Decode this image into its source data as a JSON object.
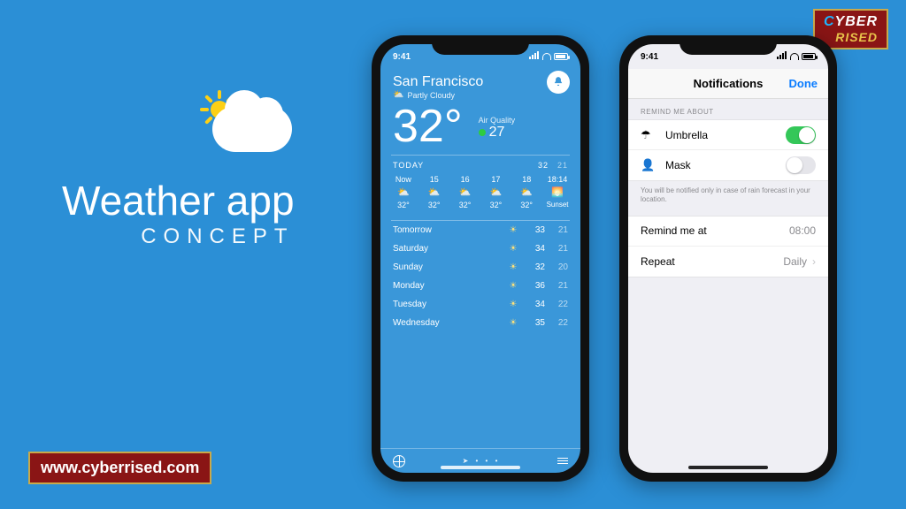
{
  "brand": {
    "prefix": "C",
    "rest": "YBER",
    "line2": "RISED"
  },
  "url": "www.cyberrised.com",
  "title": "Weather app",
  "subtitle": "CONCEPT",
  "status_time": "9:41",
  "weather": {
    "city": "San Francisco",
    "condition": "Partly Cloudy",
    "temp": "32°",
    "aq_label": "Air Quality",
    "aq_value": "27",
    "today_label": "TODAY",
    "today_high": "32",
    "today_low": "21",
    "hours": [
      {
        "t": "Now",
        "temp": "32°"
      },
      {
        "t": "15",
        "temp": "32°"
      },
      {
        "t": "16",
        "temp": "32°"
      },
      {
        "t": "17",
        "temp": "32°"
      },
      {
        "t": "18",
        "temp": "32°"
      },
      {
        "t": "18:14",
        "temp": "Sunset"
      }
    ],
    "days": [
      {
        "name": "Tomorrow",
        "hi": "33",
        "lo": "21"
      },
      {
        "name": "Saturday",
        "hi": "34",
        "lo": "21"
      },
      {
        "name": "Sunday",
        "hi": "32",
        "lo": "20"
      },
      {
        "name": "Monday",
        "hi": "36",
        "lo": "21"
      },
      {
        "name": "Tuesday",
        "hi": "34",
        "lo": "22"
      },
      {
        "name": "Wednesday",
        "hi": "35",
        "lo": "22"
      }
    ]
  },
  "notif": {
    "title": "Notifications",
    "done": "Done",
    "section": "REMIND ME ABOUT",
    "umbrella": "Umbrella",
    "mask": "Mask",
    "footnote": "You will be notified only in case of rain forecast in your location.",
    "remind_label": "Remind me at",
    "remind_value": "08:00",
    "repeat_label": "Repeat",
    "repeat_value": "Daily"
  }
}
